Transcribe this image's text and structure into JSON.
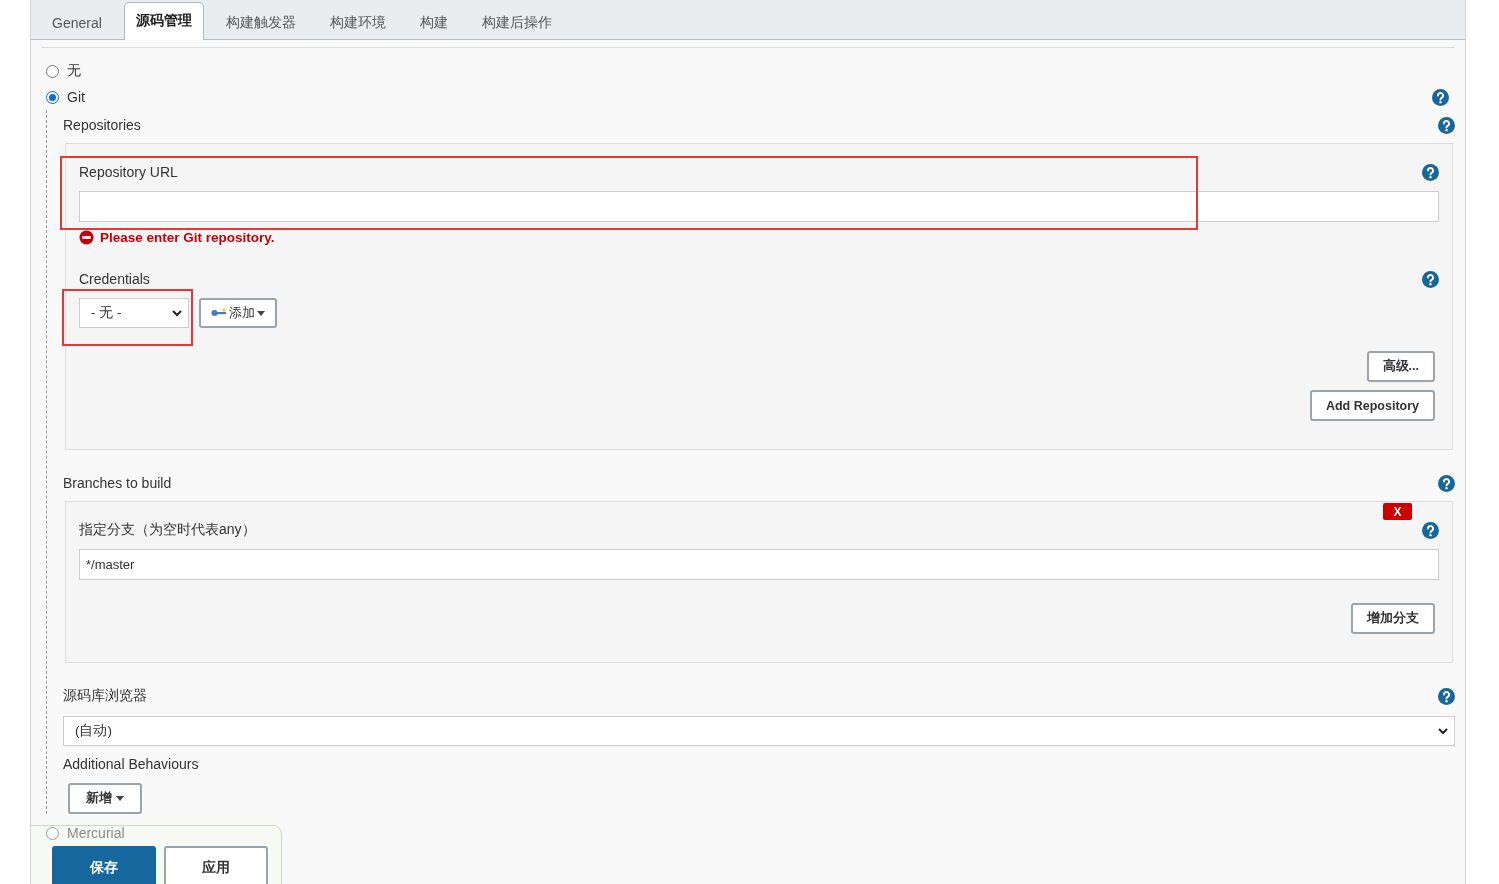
{
  "tabs": [
    {
      "label": "General",
      "selected": false
    },
    {
      "label": "源码管理",
      "selected": true
    },
    {
      "label": "构建触发器",
      "selected": false
    },
    {
      "label": "构建环境",
      "selected": false
    },
    {
      "label": "构建",
      "selected": false
    },
    {
      "label": "构建后操作",
      "selected": false
    }
  ],
  "scm_options": [
    {
      "label": "无",
      "selected": false
    },
    {
      "label": "Git",
      "selected": true
    },
    {
      "label": "Mercurial",
      "selected": false
    }
  ],
  "git": {
    "repositories_label": "Repositories",
    "repository_url": {
      "label": "Repository URL",
      "error": "Please enter Git repository."
    },
    "credentials": {
      "label": "Credentials",
      "value": "- 无 -",
      "add_button": "添加"
    },
    "advanced_button": "高级...",
    "add_repository_button": "Add Repository",
    "branches_label": "Branches to build",
    "branch": {
      "label": "指定分支（为空时代表any）",
      "value": "*/master",
      "delete_button": "X"
    },
    "add_branch_button": "增加分支",
    "browser": {
      "label": "源码库浏览器",
      "value": "(自动)"
    },
    "behaviours_label": "Additional Behaviours",
    "add_behaviour_button": "新增"
  },
  "footer_buttons": [
    {
      "label": "保存",
      "kind": "primary"
    },
    {
      "label": "应用",
      "kind": "secondary"
    }
  ]
}
